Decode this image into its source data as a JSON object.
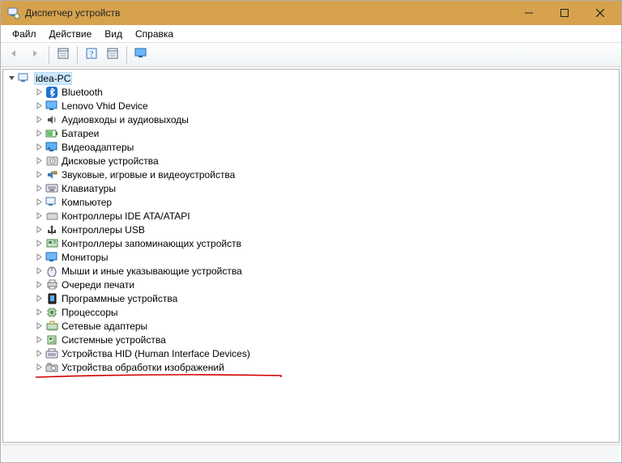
{
  "window": {
    "title": "Диспетчер устройств"
  },
  "menu": {
    "items": [
      "Файл",
      "Действие",
      "Вид",
      "Справка"
    ]
  },
  "tree": {
    "root": "idea-PC",
    "children": [
      {
        "icon": "bluetooth",
        "label": "Bluetooth"
      },
      {
        "icon": "monitor",
        "label": "Lenovo Vhid Device"
      },
      {
        "icon": "audio",
        "label": "Аудиовходы и аудиовыходы"
      },
      {
        "icon": "battery",
        "label": "Батареи"
      },
      {
        "icon": "display-adapter",
        "label": "Видеоадаптеры"
      },
      {
        "icon": "disk",
        "label": "Дисковые устройства"
      },
      {
        "icon": "sound-game",
        "label": "Звуковые, игровые и видеоустройства"
      },
      {
        "icon": "keyboard",
        "label": "Клавиатуры"
      },
      {
        "icon": "computer",
        "label": "Компьютер"
      },
      {
        "icon": "ide",
        "label": "Контроллеры IDE ATA/ATAPI"
      },
      {
        "icon": "usb",
        "label": "Контроллеры USB"
      },
      {
        "icon": "storage-controller",
        "label": "Контроллеры запоминающих устройств"
      },
      {
        "icon": "monitor",
        "label": "Мониторы"
      },
      {
        "icon": "mouse",
        "label": "Мыши и иные указывающие устройства"
      },
      {
        "icon": "printer",
        "label": "Очереди печати"
      },
      {
        "icon": "software-device",
        "label": "Программные устройства"
      },
      {
        "icon": "cpu",
        "label": "Процессоры"
      },
      {
        "icon": "network",
        "label": "Сетевые адаптеры"
      },
      {
        "icon": "system",
        "label": "Системные устройства"
      },
      {
        "icon": "hid",
        "label": "Устройства HID (Human Interface Devices)"
      },
      {
        "icon": "imaging",
        "label": "Устройства обработки изображений"
      }
    ]
  },
  "annotation": {
    "underline_color": "#d30000"
  }
}
